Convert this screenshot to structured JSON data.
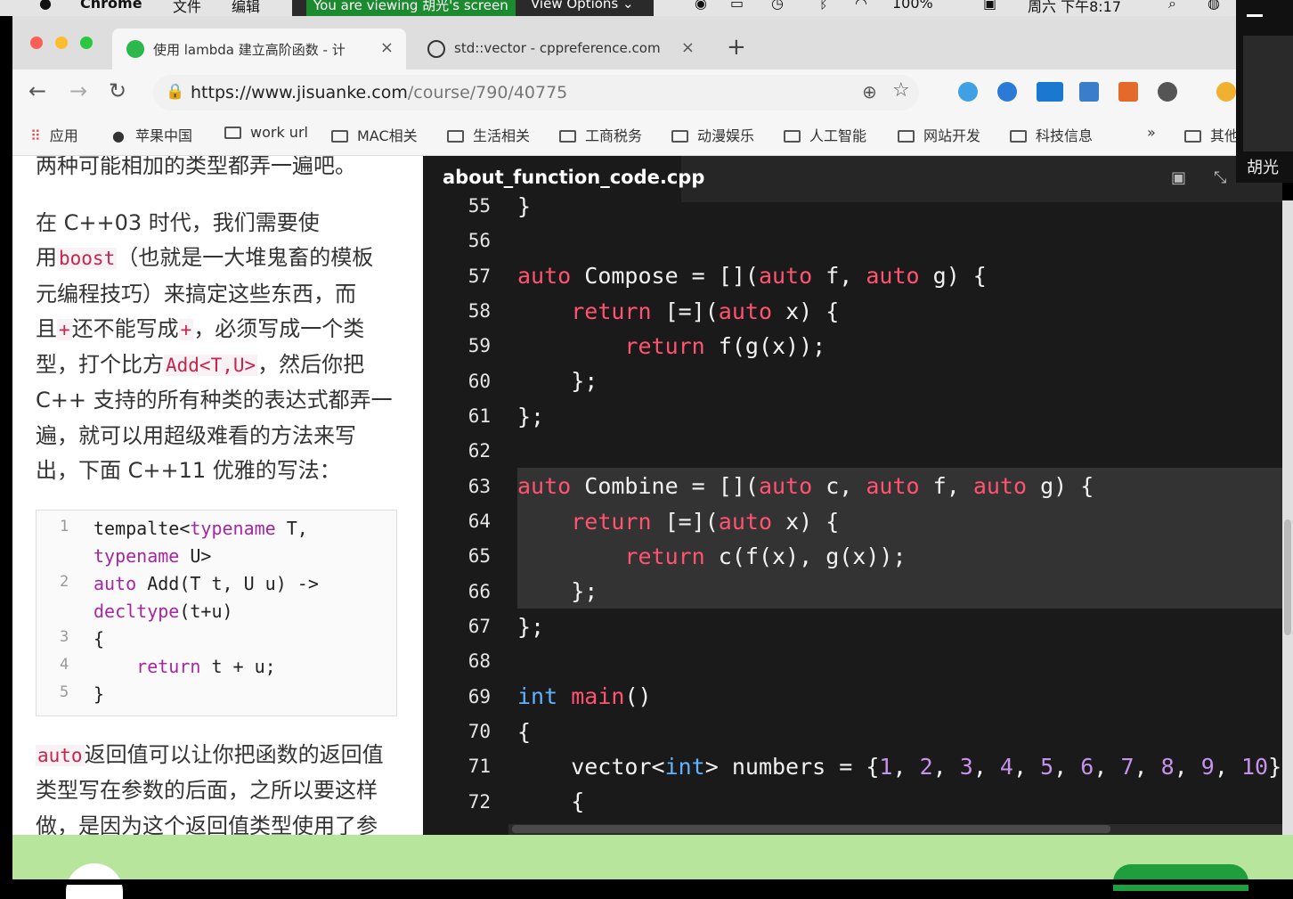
{
  "menubar": {
    "app_name": "Chrome",
    "menu_file": "文件",
    "menu_edit": "编辑",
    "share_text": "You are viewing 胡光's screen",
    "view_options": "View Options",
    "battery": "100%",
    "clock": "周六 下午8:17"
  },
  "browser": {
    "tabs": [
      {
        "label": "使用 lambda 建立高阶函数 - 计",
        "close": "×"
      },
      {
        "label": "std::vector - cppreference.com",
        "close": "×"
      }
    ],
    "new_tab": "+",
    "url_domain": "https://www.jisuanke.com",
    "url_path": "/course/790/40775",
    "bookmarks": [
      "应用",
      "苹果中国",
      "work url",
      "MAC相关",
      "生活相关",
      "工商税务",
      "动漫娱乐",
      "人工智能",
      "网站开发",
      "科技信息"
    ],
    "bookmarks_more": "»",
    "bookmarks_overflow": "其他"
  },
  "article": {
    "p0": "两种可能相加的类型都弄一遍吧。",
    "p1_line1": "在 C++03 时代，我们需要使",
    "p1_line2_pre": "用",
    "p1_code_boost": "boost",
    "p1_line2_post": "（也就是一大堆鬼畜的模板",
    "p1_line3": "元编程技巧）来搞定这些东西，而",
    "p1_line4_pre": "且",
    "p1_code_plus1": "+",
    "p1_line4_mid": "还不能写成",
    "p1_code_plus2": "+",
    "p1_line4_post": "，必须写成一个类",
    "p1_line5_pre": "型，打个比方",
    "p1_code_add": "Add<T,U>",
    "p1_line5_post": "，然后你把",
    "p1_line6": "C++ 支持的所有种类的表达式都弄一",
    "p1_line7": "遍，就可以用超级难看的方法来写",
    "p1_line8": "出，下面 C++11 优雅的写法：",
    "snippet": [
      {
        "n": "1",
        "a": "tempalte<",
        "kw": "typename",
        "b": " T,"
      },
      {
        "n": "",
        "a": "",
        "kw": "typename",
        "b": " U>"
      },
      {
        "n": "2",
        "a": "",
        "kw": "auto",
        "b": " Add(T t, U u) ->"
      },
      {
        "n": "",
        "a": "",
        "kw": "decltype",
        "b": "(t+u)"
      },
      {
        "n": "3",
        "a": "{",
        "kw": "",
        "b": ""
      },
      {
        "n": "4",
        "a": "    ",
        "kw": "return",
        "b": " t + u;"
      },
      {
        "n": "5",
        "a": "}",
        "kw": "",
        "b": ""
      }
    ],
    "p2_code": "auto",
    "p2_line1": "返回值可以让你把函数的返回值",
    "p2_line2": "类型写在参数的后面，之所以要这样",
    "p2_line3": "做，是因为这个返回值类型使用了参"
  },
  "editor": {
    "filename": "about_function_code.cpp",
    "line_numbers": [
      "55",
      "56",
      "57",
      "58",
      "59",
      "60",
      "61",
      "62",
      "63",
      "64",
      "65",
      "66",
      "67",
      "68",
      "69",
      "70",
      "71",
      "72"
    ]
  },
  "video": {
    "name": "胡光"
  }
}
